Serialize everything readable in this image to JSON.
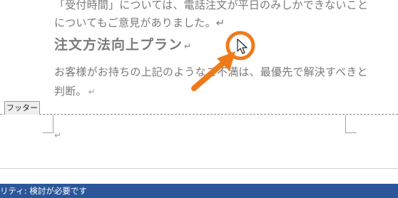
{
  "document": {
    "line1": "「受付時間」については、電話注文が平日のみしかできないこと",
    "line2": "についてもご意見がありました。↵",
    "heading": "注文方法向上プラン",
    "heading_mark": "↵",
    "line3": "お客様がお持ちの上記のようなご不満は、最優先で解決すべきと",
    "line4": "判断。",
    "line4_mark": "↵",
    "footer_mark": "↵"
  },
  "footer": {
    "tab_label": "フッター"
  },
  "statusbar": {
    "text": "リティ: 検討が必要です"
  },
  "colors": {
    "accent_orange": "#f07a1a",
    "statusbar_blue": "#2b579a"
  },
  "icons": {
    "cursor": "mouse-pointer-icon",
    "highlight": "orange-circle-highlight",
    "pointer": "orange-arrow"
  }
}
